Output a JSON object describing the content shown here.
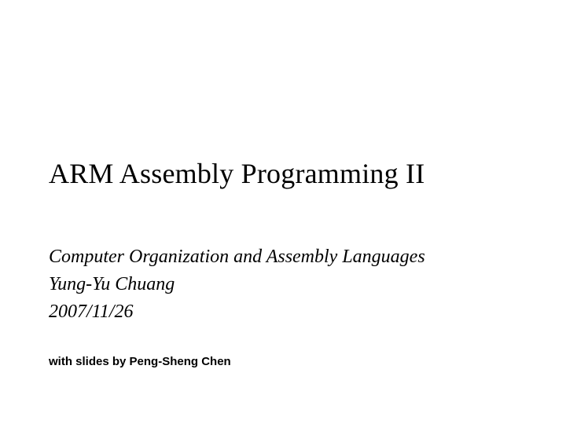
{
  "slide": {
    "title": "ARM Assembly Programming II",
    "subtitle": {
      "course": "Computer Organization and Assembly Languages",
      "author": "Yung-Yu Chuang",
      "date": "2007/11/26"
    },
    "credit": "with slides by Peng-Sheng Chen"
  }
}
